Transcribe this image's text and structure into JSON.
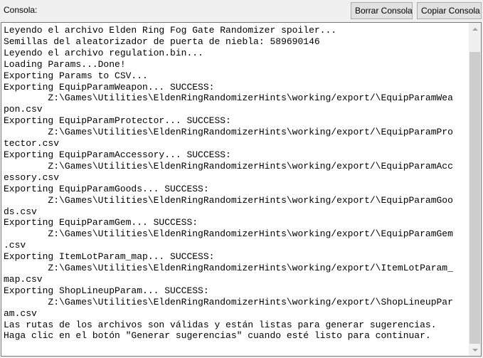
{
  "header": {
    "label": "Consola:",
    "clear_button": "Borrar Consola",
    "copy_button": "Copiar Consola"
  },
  "console": {
    "lines": [
      "Leyendo el archivo Elden Ring Fog Gate Randomizer spoiler...",
      "Semillas del aleatorizador de puerta de niebla: 589690146",
      "Leyendo el archivo regulation.bin...",
      "Loading Params...Done!",
      "Exporting Params to CSV...",
      "Exporting EquipParamWeapon... SUCCESS:",
      "        Z:\\Games\\Utilities\\EldenRingRandomizerHints\\working/export/\\EquipParamWea",
      "pon.csv",
      "Exporting EquipParamProtector... SUCCESS:",
      "        Z:\\Games\\Utilities\\EldenRingRandomizerHints\\working/export/\\EquipParamPro",
      "tector.csv",
      "Exporting EquipParamAccessory... SUCCESS:",
      "        Z:\\Games\\Utilities\\EldenRingRandomizerHints\\working/export/\\EquipParamAcc",
      "essory.csv",
      "Exporting EquipParamGoods... SUCCESS:",
      "        Z:\\Games\\Utilities\\EldenRingRandomizerHints\\working/export/\\EquipParamGoo",
      "ds.csv",
      "Exporting EquipParamGem... SUCCESS:",
      "        Z:\\Games\\Utilities\\EldenRingRandomizerHints\\working/export/\\EquipParamGem",
      ".csv",
      "Exporting ItemLotParam_map... SUCCESS:",
      "        Z:\\Games\\Utilities\\EldenRingRandomizerHints\\working/export/\\ItemLotParam_",
      "map.csv",
      "Exporting ShopLineupParam... SUCCESS:",
      "        Z:\\Games\\Utilities\\EldenRingRandomizerHints\\working/export/\\ShopLineupPar",
      "am.csv",
      "Las rutas de los archivos son válidas y están listas para generar sugerencias.",
      "Haga clic en el botón \"Generar sugerencias\" cuando esté listo para continuar."
    ]
  },
  "icons": {
    "scroll_up": "scroll-up-arrow-icon",
    "scroll_down": "scroll-down-arrow-icon"
  },
  "colors": {
    "background": "#f0f0f0",
    "console_background": "#ffffff",
    "scroll_thumb": "#cdcdcd"
  }
}
